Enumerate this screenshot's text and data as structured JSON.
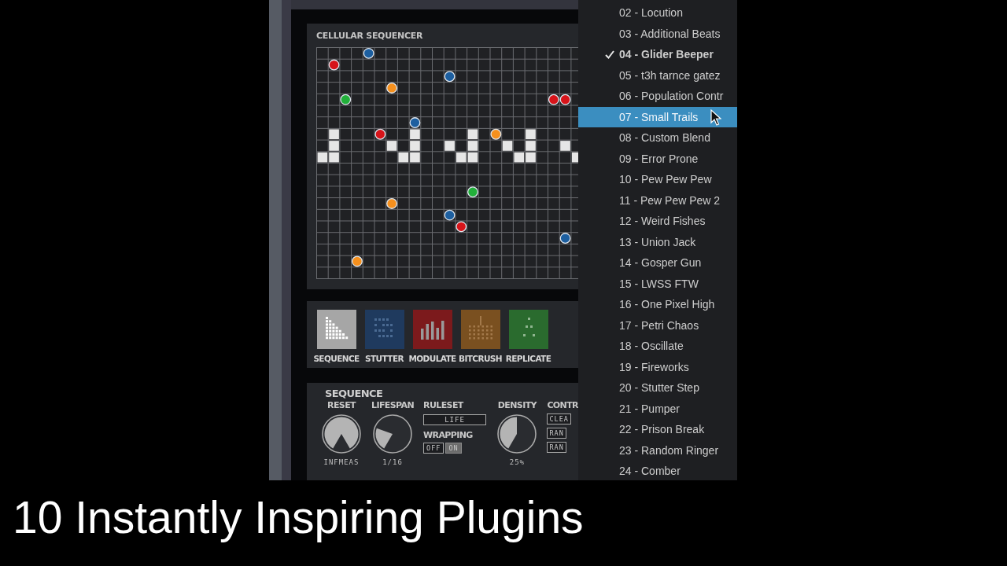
{
  "sequencer": {
    "title": "CELLULAR SEQUENCER"
  },
  "effects": [
    {
      "label": "SEQUENCE",
      "kind": "sequence",
      "color": "#a6a6a6"
    },
    {
      "label": "STUTTER",
      "kind": "stutter",
      "color": "#1f3a5e"
    },
    {
      "label": "MODULATE",
      "kind": "modulate",
      "color": "#7c1a1c"
    },
    {
      "label": "BITCRUSH",
      "kind": "bitcrush",
      "color": "#7a5020"
    },
    {
      "label": "REPLICATE",
      "kind": "replicate",
      "color": "#2a6b2e"
    }
  ],
  "sequence_panel": {
    "title": "SEQUENCE",
    "knobs": [
      {
        "label": "RESET",
        "value": "INFMEAS"
      },
      {
        "label": "LIFESPAN",
        "value": "1/16"
      },
      {
        "label": "DENSITY",
        "value": "25%"
      }
    ],
    "ruleset": {
      "label": "RULESET",
      "value": "LIFE"
    },
    "wrapping": {
      "label": "WRAPPING",
      "options": [
        {
          "label": "OFF",
          "selected": false
        },
        {
          "label": "ON",
          "selected": true
        }
      ]
    },
    "controls": {
      "label": "CONTR",
      "buttons": [
        "CLEA",
        "RAN",
        "RAN"
      ]
    }
  },
  "preset_menu": {
    "items": [
      {
        "label": "02 - Locution",
        "checked": false,
        "selected": false
      },
      {
        "label": "03 - Additional Beats",
        "checked": false,
        "selected": false
      },
      {
        "label": "04 - Glider Beeper",
        "checked": true,
        "selected": false
      },
      {
        "label": "05 - t3h tarnce gatez",
        "checked": false,
        "selected": false
      },
      {
        "label": "06 - Population Contr",
        "checked": false,
        "selected": false
      },
      {
        "label": "07 - Small Trails",
        "checked": false,
        "selected": true
      },
      {
        "label": "08 - Custom Blend",
        "checked": false,
        "selected": false
      },
      {
        "label": "09 - Error Prone",
        "checked": false,
        "selected": false
      },
      {
        "label": "10 - Pew Pew Pew",
        "checked": false,
        "selected": false
      },
      {
        "label": "11 - Pew Pew Pew 2",
        "checked": false,
        "selected": false
      },
      {
        "label": "12 - Weird Fishes",
        "checked": false,
        "selected": false
      },
      {
        "label": "13 - Union Jack",
        "checked": false,
        "selected": false
      },
      {
        "label": "14 - Gosper Gun",
        "checked": false,
        "selected": false
      },
      {
        "label": "15 - LWSS FTW",
        "checked": false,
        "selected": false
      },
      {
        "label": "16 - One Pixel High",
        "checked": false,
        "selected": false
      },
      {
        "label": "17 - Petri Chaos",
        "checked": false,
        "selected": false
      },
      {
        "label": "18 - Oscillate",
        "checked": false,
        "selected": false
      },
      {
        "label": "19 - Fireworks",
        "checked": false,
        "selected": false
      },
      {
        "label": "20 - Stutter Step",
        "checked": false,
        "selected": false
      },
      {
        "label": "21 - Pumper",
        "checked": false,
        "selected": false
      },
      {
        "label": "22 - Prison Break",
        "checked": false,
        "selected": false
      },
      {
        "label": "23 - Random Ringer",
        "checked": false,
        "selected": false
      },
      {
        "label": "24 - Comber",
        "checked": false,
        "selected": false
      }
    ]
  },
  "caption": "10 Instantly Inspiring Plugins"
}
